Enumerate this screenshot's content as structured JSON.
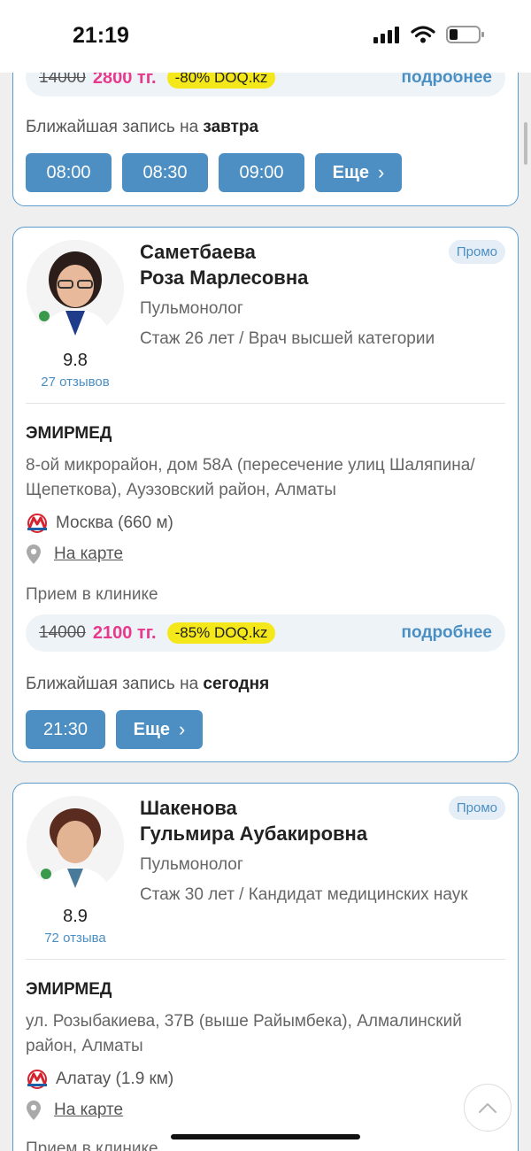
{
  "status_bar": {
    "time": "21:19"
  },
  "card1": {
    "old_price": "14000",
    "new_price": "2800 тг.",
    "discount": "-80%  DOQ.kz",
    "more": "подробнее",
    "nearest_prefix": "Ближайшая запись на",
    "nearest_day": "завтра",
    "slots": [
      "08:00",
      "08:30",
      "09:00"
    ],
    "more_slots": "Еще"
  },
  "card2": {
    "last_name": "Саметбаева",
    "first_name": "Роза Марлесовна",
    "specialty": "Пульмонолог",
    "experience": "Стаж 26 лет / Врач высшей категории",
    "promo": "Промо",
    "rating": "9.8",
    "reviews": "27 отзывов",
    "clinic": "ЭМИРМЕД",
    "address": "8-ой микрорайон, дом 58А (пересечение улиц Шаляпина/Щепеткова), Ауэзовский район, Алматы",
    "metro": "Москва (660 м)",
    "map": "На карте",
    "reception": "Прием в клинике",
    "old_price": "14000",
    "new_price": "2100 тг.",
    "discount": "-85%  DOQ.kz",
    "more": "подробнее",
    "nearest_prefix": "Ближайшая запись на",
    "nearest_day": "сегодня",
    "slots": [
      "21:30"
    ],
    "more_slots": "Еще"
  },
  "card3": {
    "last_name": "Шакенова",
    "first_name": "Гульмира Аубакировна",
    "specialty": "Пульмонолог",
    "experience": "Стаж 30 лет / Кандидат медицинских наук",
    "promo": "Промо",
    "rating": "8.9",
    "reviews": "72 отзыва",
    "clinic": "ЭМИРМЕД",
    "address": "ул. Розыбакиева, 37В (выше Райымбека), Алмалинский район, Алматы",
    "metro": "Алатау (1.9 км)",
    "map": "На карте",
    "reception": "Прием в клинике"
  },
  "colors": {
    "accent": "#4d8fc3",
    "price": "#e83a8c",
    "discount_bg": "#f4e81a",
    "border": "#5b9ccd"
  },
  "icons": [
    "battery-icon",
    "wifi-icon",
    "signal-icon",
    "metro-icon",
    "map-pin-icon",
    "chevron-right-icon",
    "chevron-up-icon"
  ]
}
